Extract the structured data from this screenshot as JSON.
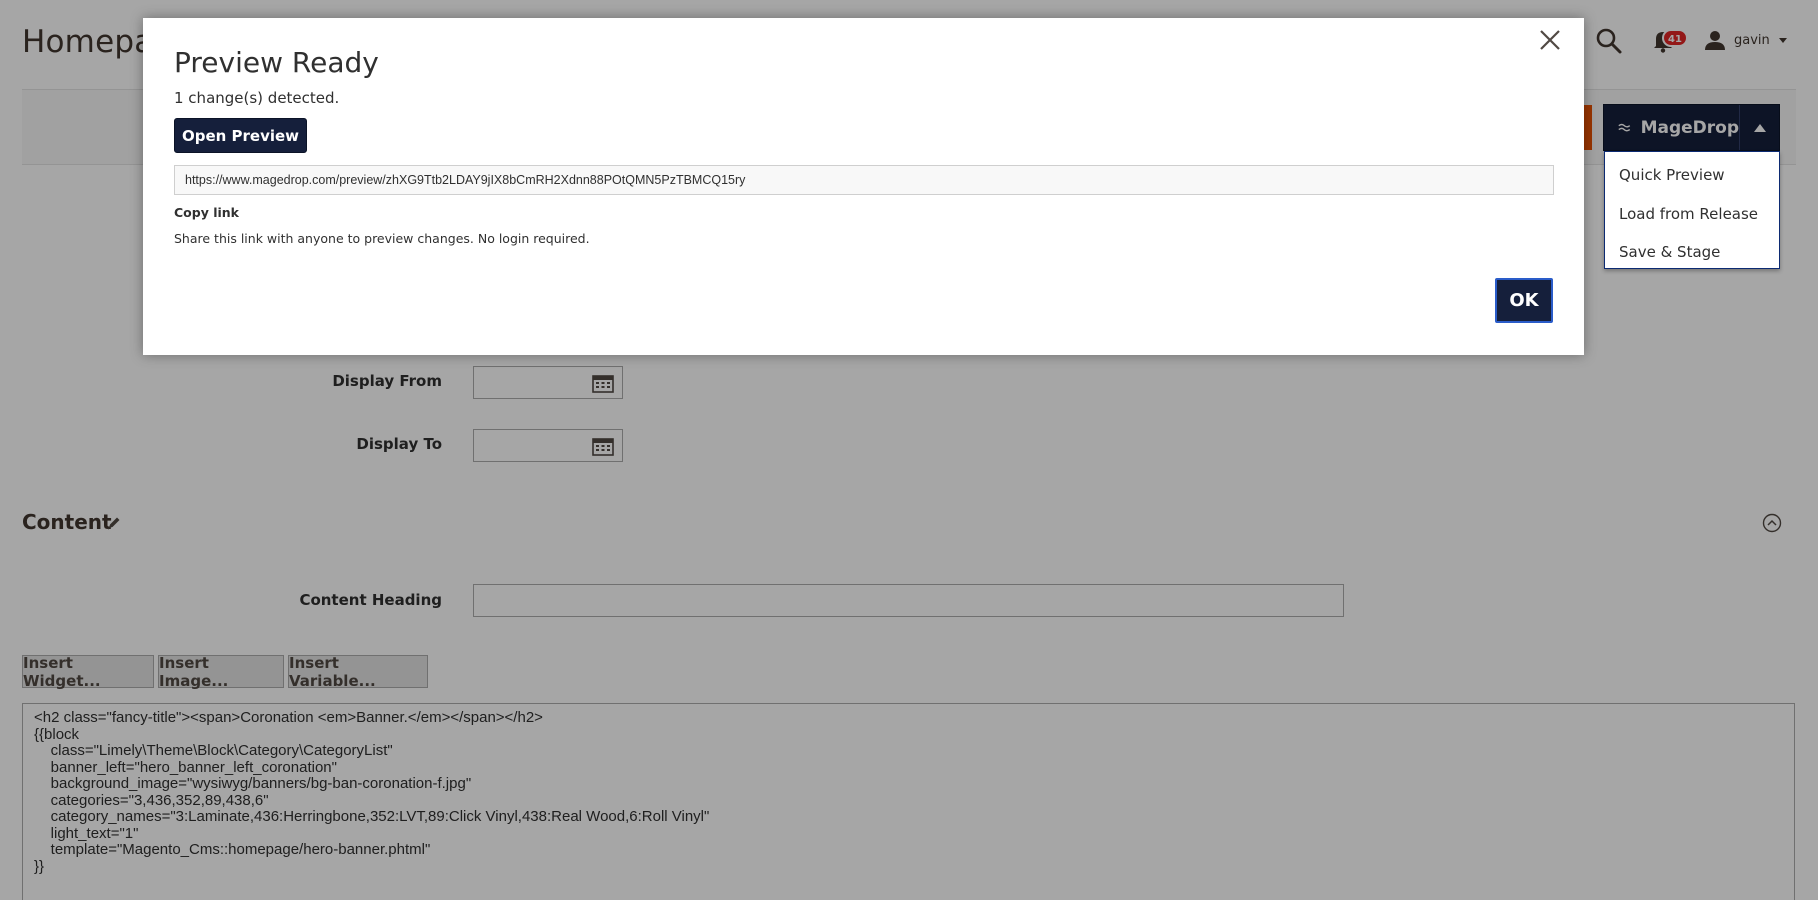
{
  "page": {
    "title": "Homepage"
  },
  "header": {
    "notifications_count": "41",
    "username": "gavin"
  },
  "magedrop": {
    "label": "MageDrop",
    "menu": [
      {
        "label": "Quick Preview"
      },
      {
        "label": "Load from Release"
      },
      {
        "label": "Save & Stage"
      }
    ]
  },
  "form": {
    "display_from_label": "Display From",
    "display_to_label": "Display To",
    "content_section_title": "Content",
    "content_heading_label": "Content Heading"
  },
  "wysiwyg": {
    "insert_widget": "Insert Widget...",
    "insert_image": "Insert Image...",
    "insert_variable": "Insert Variable...",
    "lines": [
      "<h2 class=\"fancy-title\"><span>Coronation <em>Banner.</em></span></h2>",
      "",
      "{{block",
      "    class=\"Limely\\Theme\\Block\\Category\\CategoryList\"",
      "    banner_left=\"hero_banner_left_coronation\"",
      "    background_image=\"wysiwyg/banners/bg-ban-coronation-f.jpg\"",
      "    categories=\"3,436,352,89,438,6\"",
      "    category_names=\"3:Laminate,436:Herringbone,352:LVT,89:Click Vinyl,438:Real Wood,6:Roll Vinyl\"",
      "    light_text=\"1\"",
      "    template=\"Magento_Cms::homepage/hero-banner.phtml\"",
      "}}"
    ]
  },
  "modal": {
    "title": "Preview Ready",
    "changes_text": "1 change(s) detected.",
    "open_preview_label": "Open Preview",
    "preview_url": "https://www.magedrop.com/preview/zhXG9Ttb2LDAY9jIX8bCmRH2Xdnn88POtQMN5PzTBMCQ15ry",
    "copy_link_label": "Copy link",
    "share_hint": "Share this link with anyone to preview changes. No login required.",
    "ok_label": "OK"
  },
  "colors": {
    "brand_dark": "#151f3b",
    "accent_orange": "#eb5202",
    "badge_red": "#e22626"
  }
}
